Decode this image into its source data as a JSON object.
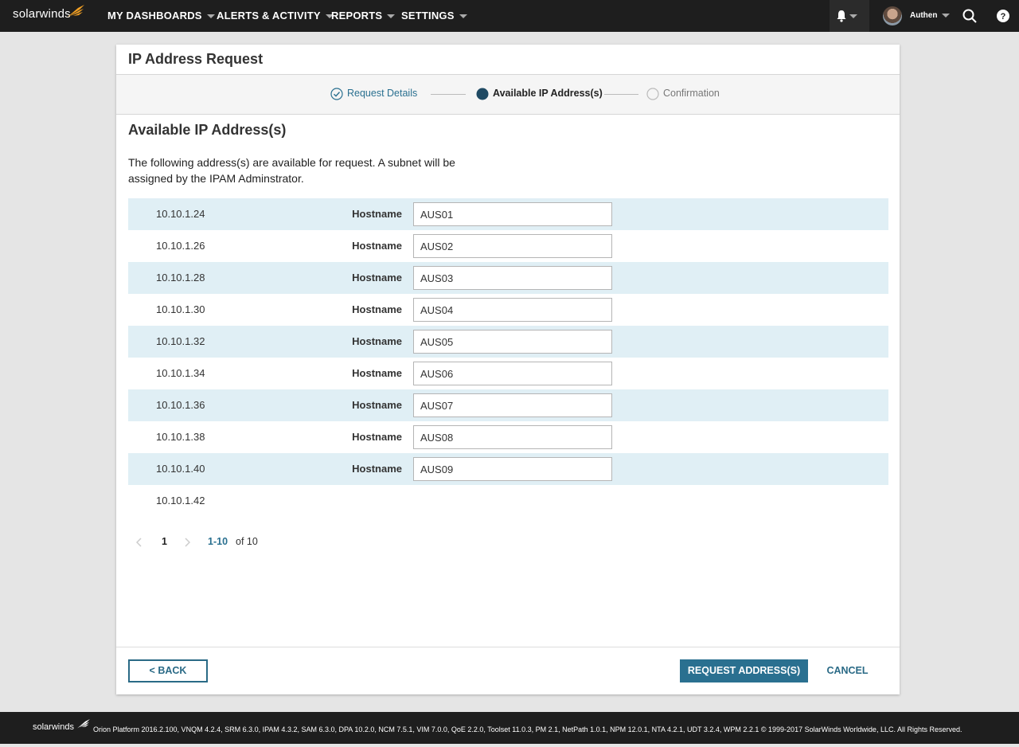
{
  "nav": {
    "logo": "solarwinds",
    "items": [
      {
        "label": "MY DASHBOARDS"
      },
      {
        "label": "ALERTS & ACTIVITY"
      },
      {
        "label": "REPORTS"
      },
      {
        "label": "SETTINGS"
      }
    ],
    "user": "Authen"
  },
  "page": {
    "title": "IP Address Request",
    "wizard": {
      "steps": [
        {
          "label": "Request Details",
          "state": "complete"
        },
        {
          "label": "Available IP Address(s)",
          "state": "current"
        },
        {
          "label": "Confirmation",
          "state": "pending"
        }
      ]
    },
    "section_title": "Available IP Address(s)",
    "description": "The following address(s) are available for request.  A subnet will be assigned by the IPAM Adminstrator.",
    "hostname_label": "Hostname",
    "rows": [
      {
        "ip": "10.10.1.24",
        "hostname": "AUS01"
      },
      {
        "ip": "10.10.1.26",
        "hostname": "AUS02"
      },
      {
        "ip": "10.10.1.28",
        "hostname": "AUS03"
      },
      {
        "ip": "10.10.1.30",
        "hostname": "AUS04"
      },
      {
        "ip": "10.10.1.32",
        "hostname": "AUS05"
      },
      {
        "ip": "10.10.1.34",
        "hostname": "AUS06"
      },
      {
        "ip": "10.10.1.36",
        "hostname": "AUS07"
      },
      {
        "ip": "10.10.1.38",
        "hostname": "AUS08"
      },
      {
        "ip": "10.10.1.40",
        "hostname": "AUS09"
      },
      {
        "ip": "10.10.1.42",
        "hostname": ""
      }
    ],
    "pagination": {
      "page": "1",
      "range": "1-10",
      "total": "of 10"
    },
    "buttons": {
      "back": "< BACK",
      "request": "REQUEST ADDRESS(S)",
      "cancel": "CANCEL"
    }
  },
  "footer": {
    "logo": "solarwinds",
    "text": "Orion Platform 2016.2.100, VNQM 4.2.4, SRM 6.3.0, IPAM 4.3.2, SAM 6.3.0, DPA 10.2.0, NCM 7.5.1, VIM 7.0.0, QoE 2.2.0, Toolset 11.0.3, PM 2.1, NetPath 1.0.1, NPM 12.0.1, NTA 4.2.1, UDT 3.2.4, WPM 2.2.1 © 1999-2017 SolarWinds Worldwide, LLC. All Rights Reserved."
  },
  "colors": {
    "accent": "#2a7090",
    "shaded_row": "#e0eff5",
    "brand_orange": "#f2a023"
  }
}
